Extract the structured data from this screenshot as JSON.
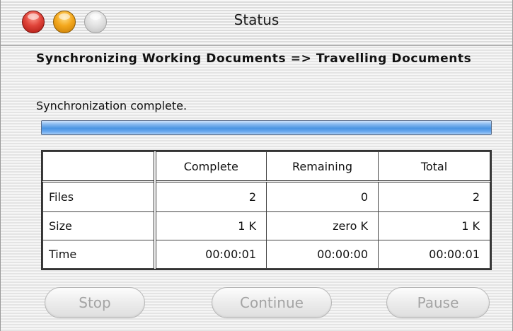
{
  "window": {
    "title": "Status"
  },
  "heading": "Synchronizing Working Documents => Travelling Documents",
  "status_message": "Synchronization complete.",
  "progress": {
    "value": 1.0
  },
  "table": {
    "columns": [
      "",
      "Complete",
      "Remaining",
      "Total"
    ],
    "rows": [
      {
        "label": "Files",
        "complete": "2",
        "remaining": "0",
        "total": "2"
      },
      {
        "label": "Size",
        "complete": "1 K",
        "remaining": "zero K",
        "total": "1 K"
      },
      {
        "label": "Time",
        "complete": "00:00:01",
        "remaining": "00:00:00",
        "total": "00:00:01"
      }
    ]
  },
  "buttons": {
    "stop": "Stop",
    "continue": "Continue",
    "pause": "Pause"
  }
}
